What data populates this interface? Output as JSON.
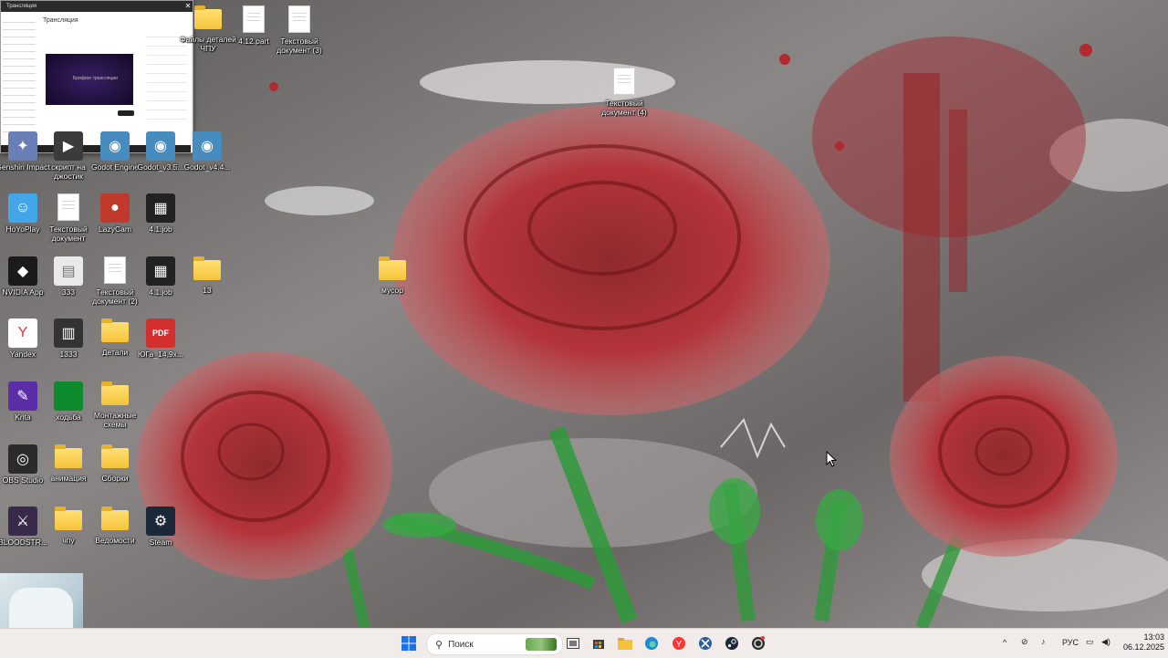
{
  "preview": {
    "title": "Трансляция",
    "video_caption": "Брифинг трансляции"
  },
  "desktop": {
    "icons": [
      {
        "id": "files",
        "label": "Файлы деталей ЧПУ",
        "kind": "folder"
      },
      {
        "id": "part",
        "label": "4.12.part",
        "kind": "doc"
      },
      {
        "id": "txt3",
        "label": "Текстовый документ (3)",
        "kind": "doc"
      },
      {
        "id": "txt4",
        "label": "Текстовый документ (4)",
        "kind": "doc"
      },
      {
        "id": "genshin",
        "label": "Genshin Impact",
        "kind": "app"
      },
      {
        "id": "script",
        "label": "скрипт на джостик",
        "kind": "app"
      },
      {
        "id": "godot",
        "label": "Godot Engine",
        "kind": "app"
      },
      {
        "id": "godot35",
        "label": "Godot_v3.5...",
        "kind": "app"
      },
      {
        "id": "godot44",
        "label": "Godot_v4.4...",
        "kind": "app"
      },
      {
        "id": "hoyo",
        "label": "HoYoPlay",
        "kind": "app"
      },
      {
        "id": "txt",
        "label": "Текстовый документ",
        "kind": "doc"
      },
      {
        "id": "lazycam",
        "label": "LazyCam",
        "kind": "app"
      },
      {
        "id": "job1",
        "label": "4.1.job",
        "kind": "app"
      },
      {
        "id": "nvidia",
        "label": "NVIDIA App",
        "kind": "app"
      },
      {
        "id": "i333",
        "label": "333",
        "kind": "app"
      },
      {
        "id": "txt2",
        "label": "Текстовый документ (2)",
        "kind": "doc"
      },
      {
        "id": "job2",
        "label": "4.1.job",
        "kind": "app"
      },
      {
        "id": "f13",
        "label": "13",
        "kind": "folder"
      },
      {
        "id": "trash",
        "label": "мусор",
        "kind": "folder"
      },
      {
        "id": "yandex",
        "label": "Yandex",
        "kind": "app"
      },
      {
        "id": "i1333",
        "label": "1333",
        "kind": "app"
      },
      {
        "id": "details",
        "label": "Детали",
        "kind": "folder"
      },
      {
        "id": "pdf",
        "label": "ЮГа_14,9х...",
        "kind": "app"
      },
      {
        "id": "krita",
        "label": "Krita",
        "kind": "app"
      },
      {
        "id": "walk",
        "label": "ходьба",
        "kind": "app"
      },
      {
        "id": "mount",
        "label": "Монтажные схемы",
        "kind": "folder"
      },
      {
        "id": "obs",
        "label": "OBS Studio",
        "kind": "app"
      },
      {
        "id": "anim",
        "label": "анимация",
        "kind": "folder"
      },
      {
        "id": "builds",
        "label": "Сборки",
        "kind": "folder"
      },
      {
        "id": "blood",
        "label": "BLOODSTR...",
        "kind": "app"
      },
      {
        "id": "chpu",
        "label": "чпу",
        "kind": "folder"
      },
      {
        "id": "ved",
        "label": "Ведомости",
        "kind": "folder"
      },
      {
        "id": "steam",
        "label": "Steam",
        "kind": "app"
      }
    ]
  },
  "taskbar": {
    "search_placeholder": "Поиск",
    "language": "РУС",
    "time": "13:03",
    "date": "06.12.2025",
    "pdf_badge": "PDF"
  },
  "colors": {
    "taskbar_bg": "#f1ece9",
    "folder": "#f5c33b",
    "rose": "#a8232a",
    "stem": "#2e9a3a"
  }
}
